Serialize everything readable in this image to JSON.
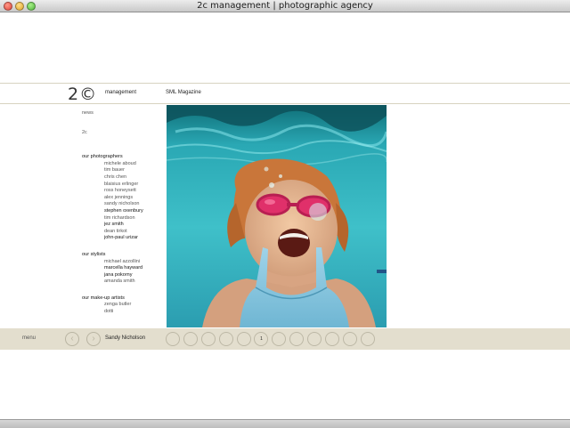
{
  "window": {
    "title": "2c management | photographic agency"
  },
  "header": {
    "logo": "2©",
    "label": "management",
    "project": "SML Magazine"
  },
  "sidebar": {
    "news": "news",
    "twoc": "2c",
    "photographers_title": "our photographers",
    "photographers": [
      "michele aboud",
      "tim bauer",
      "chris chen",
      "blaisius erlinger",
      "ross honeysett",
      "alex jennings",
      "sandy nicholson",
      "stephen oxenbury",
      "tim richardson",
      "jez smith",
      "dean tirkot",
      "john-paul urizar"
    ],
    "stylists_title": "our stylists",
    "stylists": [
      "michael azzollini",
      "marcella hayward",
      "jana pokorny",
      "amanda smith"
    ],
    "makeup_title": "our make-up artists",
    "makeup": [
      "zenga butler",
      "dotti"
    ]
  },
  "bottombar": {
    "menu": "menu",
    "prev": "‹",
    "next": "›",
    "photographer": "Sandy Nicholson",
    "pages": [
      "",
      "",
      "",
      "",
      "",
      "1",
      "",
      "",
      "",
      "",
      "",
      ""
    ]
  },
  "colors": {
    "bar": "#e3dece",
    "water": "#29a6b3",
    "goggles": "#e0306a"
  }
}
